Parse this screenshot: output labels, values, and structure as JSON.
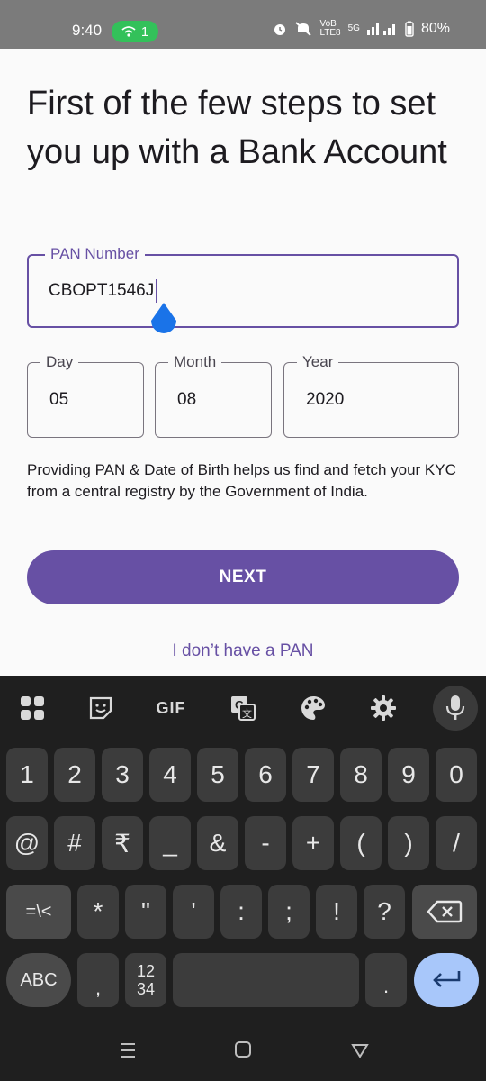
{
  "status": {
    "time": "9:40",
    "wifi_count": "1",
    "net_small_top": "VoB",
    "net_small_bottom": "LTE8",
    "net_5g": "5G",
    "battery": "80%"
  },
  "heading": "First of the few steps to set you up with a Bank Account",
  "pan": {
    "label": "PAN Number",
    "value": "CBOPT1546J"
  },
  "dob": {
    "day": {
      "label": "Day",
      "value": "05"
    },
    "month": {
      "label": "Month",
      "value": "08"
    },
    "year": {
      "label": "Year",
      "value": "2020"
    }
  },
  "info_text": "Providing PAN & Date of Birth helps us find and fetch your KYC from a central registry by the Government of India.",
  "next_button": "NEXT",
  "no_pan_link": "I don’t have a PAN",
  "keyboard": {
    "toolbar": {
      "gif": "GIF"
    },
    "row_numbers": [
      "1",
      "2",
      "3",
      "4",
      "5",
      "6",
      "7",
      "8",
      "9",
      "0"
    ],
    "row_symbols": [
      "@",
      "#",
      "₹",
      "_",
      "&",
      "-",
      "+",
      "(",
      ")",
      "/"
    ],
    "row_punct": [
      "=\\<",
      "*",
      "\"",
      "'",
      ":",
      ";",
      "!",
      "?"
    ],
    "abc": "ABC",
    "comma": ",",
    "num_toggle": "12\n34",
    "period": "."
  },
  "colors": {
    "accent": "#6750a4",
    "keyboard_bg": "#1f1f1f",
    "enter": "#a8c7fa"
  }
}
